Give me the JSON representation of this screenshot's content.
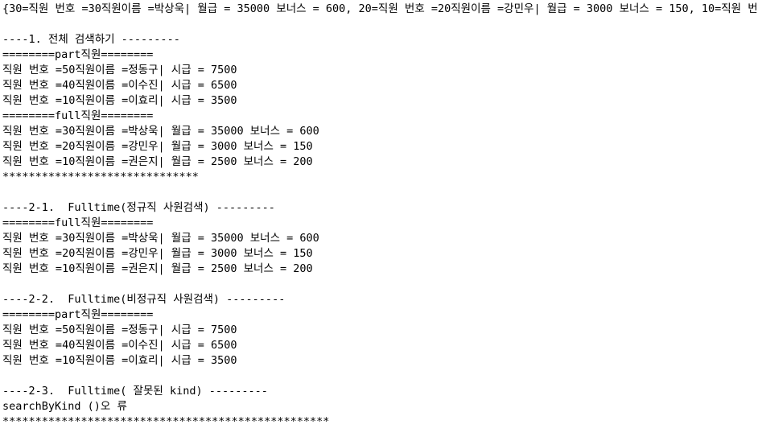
{
  "console": {
    "lines": [
      "{30=직원 번호 =30직원이름 =박상욱| 월급 = 35000 보너스 = 600, 20=직원 번호 =20직원이름 =강민우| 월급 = 3000 보너스 = 150, 10=직원 번",
      "",
      "----1. 전체 검색하기 ---------",
      "========part직원========",
      "직원 번호 =50직원이름 =정동구| 시급 = 7500",
      "직원 번호 =40직원이름 =이수진| 시급 = 6500",
      "직원 번호 =10직원이름 =이효리| 시급 = 3500",
      "========full직원========",
      "직원 번호 =30직원이름 =박상욱| 월급 = 35000 보너스 = 600",
      "직원 번호 =20직원이름 =강민우| 월급 = 3000 보너스 = 150",
      "직원 번호 =10직원이름 =권은지| 월급 = 2500 보너스 = 200",
      "******************************",
      "",
      "----2-1.  Fulltime(정규직 사원검색) ---------",
      "========full직원========",
      "직원 번호 =30직원이름 =박상욱| 월급 = 35000 보너스 = 600",
      "직원 번호 =20직원이름 =강민우| 월급 = 3000 보너스 = 150",
      "직원 번호 =10직원이름 =권은지| 월급 = 2500 보너스 = 200",
      "",
      "----2-2.  Fulltime(비정규직 사원검색) ---------",
      "========part직원========",
      "직원 번호 =50직원이름 =정동구| 시급 = 7500",
      "직원 번호 =40직원이름 =이수진| 시급 = 6500",
      "직원 번호 =10직원이름 =이효리| 시급 = 3500",
      "",
      "----2-3.  Fulltime( 잘못된 kind) ---------",
      "searchByKind ()오 류",
      "**************************************************"
    ]
  }
}
